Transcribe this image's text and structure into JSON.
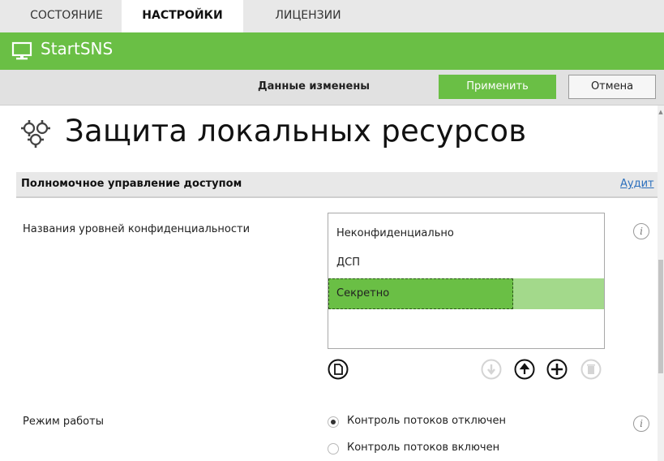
{
  "tabs": [
    {
      "label": "СОСТОЯНИЕ",
      "active": false
    },
    {
      "label": "НАСТРОЙКИ",
      "active": true
    },
    {
      "label": "ЛИЦЕНЗИИ",
      "active": false
    }
  ],
  "app": {
    "title": "StartSNS",
    "icon": "monitor-icon"
  },
  "actionbar": {
    "status": "Данные изменены",
    "apply_label": "Применить",
    "cancel_label": "Отмена"
  },
  "page": {
    "title": "Защита локальных ресурсов",
    "icon": "gears-icon"
  },
  "section": {
    "title": "Полномочное управление доступом",
    "link": "Аудит"
  },
  "levels": {
    "label": "Названия уровней конфиденциальности",
    "items": [
      "Неконфиденциально",
      "ДСП",
      "Секретно"
    ],
    "selected": "Секретно"
  },
  "mode": {
    "label": "Режим работы",
    "options": [
      "Контроль потоков отключен",
      "Контроль потоков включен"
    ],
    "selected": "Контроль потоков отключен"
  },
  "colors": {
    "accent": "#6abf45",
    "selection_light": "#a3d98b",
    "link": "#2a6fbd"
  }
}
